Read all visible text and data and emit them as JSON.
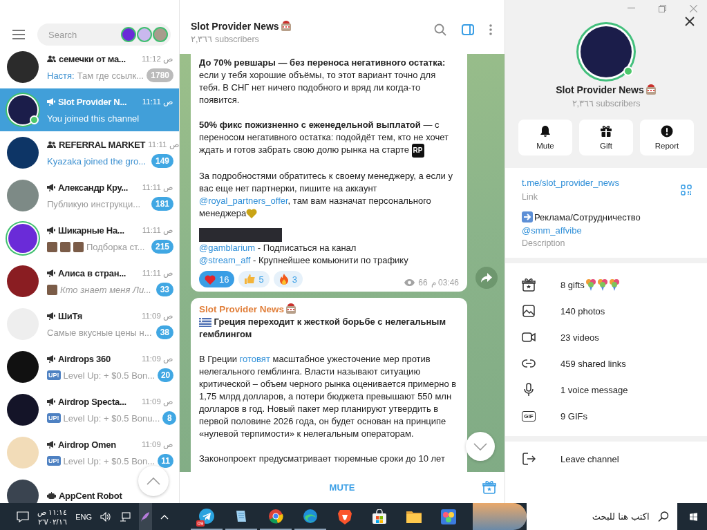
{
  "window": {
    "controls": [
      {
        "kind": "minimize"
      },
      {
        "kind": "restore"
      },
      {
        "kind": "close"
      }
    ]
  },
  "sidebar": {
    "search": {
      "placeholder": "Search"
    },
    "stories": [
      {
        "color": "#6a2bd8"
      },
      {
        "color": "#c9b8ee"
      },
      {
        "color": "#a89c8c"
      }
    ],
    "chats": [
      {
        "kind": "group",
        "name": "семечки от ма...",
        "time": "11:12 ص",
        "sender": "Настя:",
        "preview": "Там где ссылк...",
        "unread": "1780",
        "muted": true,
        "selected": false,
        "color": "#2b2b2b"
      },
      {
        "kind": "channel",
        "name": "Slot Provider N...",
        "time": "11:11 ص",
        "preview": "You joined this channel",
        "selected": true,
        "color": "#1b1d4a",
        "story": true,
        "online": true
      },
      {
        "kind": "group",
        "name": "REFERRAL MARKET",
        "time": "11:11 ص",
        "preview": "Kyazaka joined the gro...",
        "service": true,
        "unread": "149",
        "muted": false,
        "selected": false,
        "color": "#0d3566"
      },
      {
        "kind": "channel",
        "name": "Александр Кру...",
        "time": "11:11 ص",
        "preview": "Публикую инструкци...",
        "unread": "181",
        "muted": false,
        "selected": false,
        "color": "#7d8a86"
      },
      {
        "kind": "channel",
        "name": "Шикарные На...",
        "time": "11:11 ص",
        "thumbnails": [
          {
            "kind": "photo"
          },
          {
            "kind": "photo"
          },
          {
            "kind": "photo"
          }
        ],
        "preview": "Подборка ст...",
        "unread": "215",
        "muted": false,
        "selected": false,
        "color": "#6a2bd8",
        "story": true
      },
      {
        "kind": "channel",
        "name": "Алиса в стран...",
        "time": "11:11 ص",
        "thumbnails": [
          {
            "kind": "photo"
          }
        ],
        "preview": "Кто знает меня Ли...",
        "italic": true,
        "unread": "33",
        "muted": false,
        "selected": false,
        "color": "#8a1d22"
      },
      {
        "kind": "channel",
        "name": "ШиТя",
        "time": "11:09 ص",
        "preview": "Самые вкусные цены н...",
        "unread": "38",
        "muted": false,
        "selected": false,
        "color": "#eeeeee"
      },
      {
        "kind": "channel",
        "name": "Airdrops 360",
        "time": "11:09 ص",
        "prefix_badge": "UP!",
        "preview": "Level Up: + $0.5 Bon...",
        "unread": "20",
        "muted": false,
        "selected": false,
        "color": "#111111"
      },
      {
        "kind": "channel",
        "name": "Airdrop Specta...",
        "time": "11:09 ص",
        "prefix_badge": "UP!",
        "preview": "Level Up: + $0.5 Bonu...",
        "unread": "8",
        "muted": false,
        "selected": false,
        "color": "#141428"
      },
      {
        "kind": "channel",
        "name": "Airdrop Omen",
        "time": "11:09 ص",
        "prefix_badge": "UP!",
        "preview": "Level Up: + $0.5 Bon...",
        "unread": "11",
        "muted": false,
        "selected": false,
        "color": "#f2dcb8"
      },
      {
        "kind": "bot",
        "name": "AppCent Robot",
        "selected": false,
        "color": "#3a4450"
      }
    ]
  },
  "chat": {
    "title": "Slot Provider News",
    "subtitle": "٢,٣٦٦ subscribers",
    "panel_open": true,
    "messages": [
      {
        "continued": true,
        "blocks": [
          {
            "kind": "paragraph",
            "parts": [
              {
                "kind": "text",
                "text": "**До 70% ревшары — без переноса негативного остатка:** если у тебя хорошие объёмы, то этот вариант точно для тебя. В СНГ нет ничего подобного и вряд ли когда-то появится."
              }
            ]
          },
          {
            "kind": "paragraph",
            "parts": [
              {
                "kind": "text",
                "text": "**50% фикс пожизненно с еженедельной выплатой** — с переносом негативного остатка: подойдёт тем, кто не хочет ждать и готов забрать свою долю рынка на старте "
              },
              {
                "kind": "badge-emoji",
                "label": "RP"
              }
            ]
          },
          {
            "kind": "paragraph",
            "parts": [
              {
                "kind": "text",
                "text": "За подробностями обратитесь к своему менеджеру, а если у вас еще нет партнерки, пишите на аккаунт "
              },
              {
                "kind": "link",
                "text": "@royal_partners_offer"
              },
              {
                "kind": "text",
                "text": ", там вам назначат персонального менеджера"
              },
              {
                "kind": "heart-emoji"
              }
            ]
          },
          {
            "kind": "photo"
          },
          {
            "kind": "line",
            "parts": [
              {
                "kind": "link",
                "text": "@gamblarium"
              },
              {
                "kind": "text",
                "text": " - Подписаться на канал"
              }
            ]
          },
          {
            "kind": "line",
            "parts": [
              {
                "kind": "link",
                "text": "@stream_aff"
              },
              {
                "kind": "text",
                "text": " - Крупнейшее комьюнити по трафику"
              }
            ]
          }
        ],
        "reactions": [
          {
            "kind": "heart",
            "count": "16",
            "selected": true
          },
          {
            "kind": "thumbs-up",
            "count": "5",
            "selected": false
          },
          {
            "kind": "fire",
            "count": "3",
            "selected": false
          }
        ],
        "views": "66",
        "time": "03:46 م",
        "share": true
      },
      {
        "continued": false,
        "sender": "Slot Provider News",
        "blocks": [
          {
            "kind": "heading",
            "parts": [
              {
                "kind": "flag-emoji"
              },
              {
                "kind": "text",
                "text": " Греция переходит к жесткой борьбе с нелегальным гемблингом"
              }
            ]
          },
          {
            "kind": "paragraph",
            "parts": [
              {
                "kind": "text",
                "text": "В Греции "
              },
              {
                "kind": "link",
                "text": "готовят"
              },
              {
                "kind": "text",
                "text": " масштабное ужесточение мер против нелегального гемблинга. Власти называют ситуацию критической – объем черного рынка оценивается примерно в 1,75 млрд долларов, а потери бюджета превышают 550 млн долларов в год. Новый пакет мер планируют утвердить в первой половине 2026 года, он будет основан на принципе «нулевой терпимости» к нелегальным операторам."
              }
            ]
          },
          {
            "kind": "paragraph",
            "parts": [
              {
                "kind": "text",
                "text": "Законопроект предусматривает тюремные сроки до 10 лет"
              }
            ]
          }
        ],
        "share": false
      }
    ],
    "bottom": {
      "button": "MUTE"
    }
  },
  "profile": {
    "title": "Slot Provider News",
    "subtitle": "٢,٣٦٦ subscribers",
    "story": true,
    "online": true,
    "actions": [
      {
        "kind": "bell",
        "label": "Mute"
      },
      {
        "kind": "gift",
        "label": "Gift"
      },
      {
        "kind": "alert",
        "label": "Report"
      }
    ],
    "link": {
      "value": "t.me/slot_provider_news",
      "label": "Link"
    },
    "description": {
      "text": "Реклама/Сотрудничество",
      "link": "@smm_affvibe",
      "label": "Description"
    },
    "media": [
      {
        "kind": "gifts",
        "label": "8 gifts",
        "extras": [
          {
            "kind": "bouquet"
          },
          {
            "kind": "bouquet"
          },
          {
            "kind": "bouquet"
          }
        ]
      },
      {
        "kind": "photos",
        "label": "140 photos"
      },
      {
        "kind": "videos",
        "label": "23 videos"
      },
      {
        "kind": "links",
        "label": "459 shared links"
      },
      {
        "kind": "voice",
        "label": "1 voice message"
      },
      {
        "kind": "gif",
        "label": "9 GIFs",
        "icon_label": "GIF"
      }
    ],
    "leave": {
      "label": "Leave channel"
    }
  },
  "taskbar": {
    "clock": {
      "time": "١١:١٤ ص",
      "date": "٢٦/٠٢/١٦"
    },
    "language": "ENG",
    "tray": [
      {
        "kind": "volume"
      },
      {
        "kind": "network"
      },
      {
        "kind": "feather",
        "selected": true
      }
    ],
    "apps": [
      {
        "kind": "paper-plane",
        "open": true,
        "badge": "09"
      },
      {
        "kind": "notepad",
        "open": true
      },
      {
        "kind": "ring-browser",
        "open": true
      },
      {
        "kind": "wave-browser",
        "open": true
      },
      {
        "kind": "shield-browser",
        "open": false
      },
      {
        "kind": "store",
        "open": false
      },
      {
        "kind": "folder",
        "open": false
      },
      {
        "kind": "game",
        "open": false
      }
    ],
    "search": {
      "placeholder": "اكتب هنا للبحث"
    }
  }
}
